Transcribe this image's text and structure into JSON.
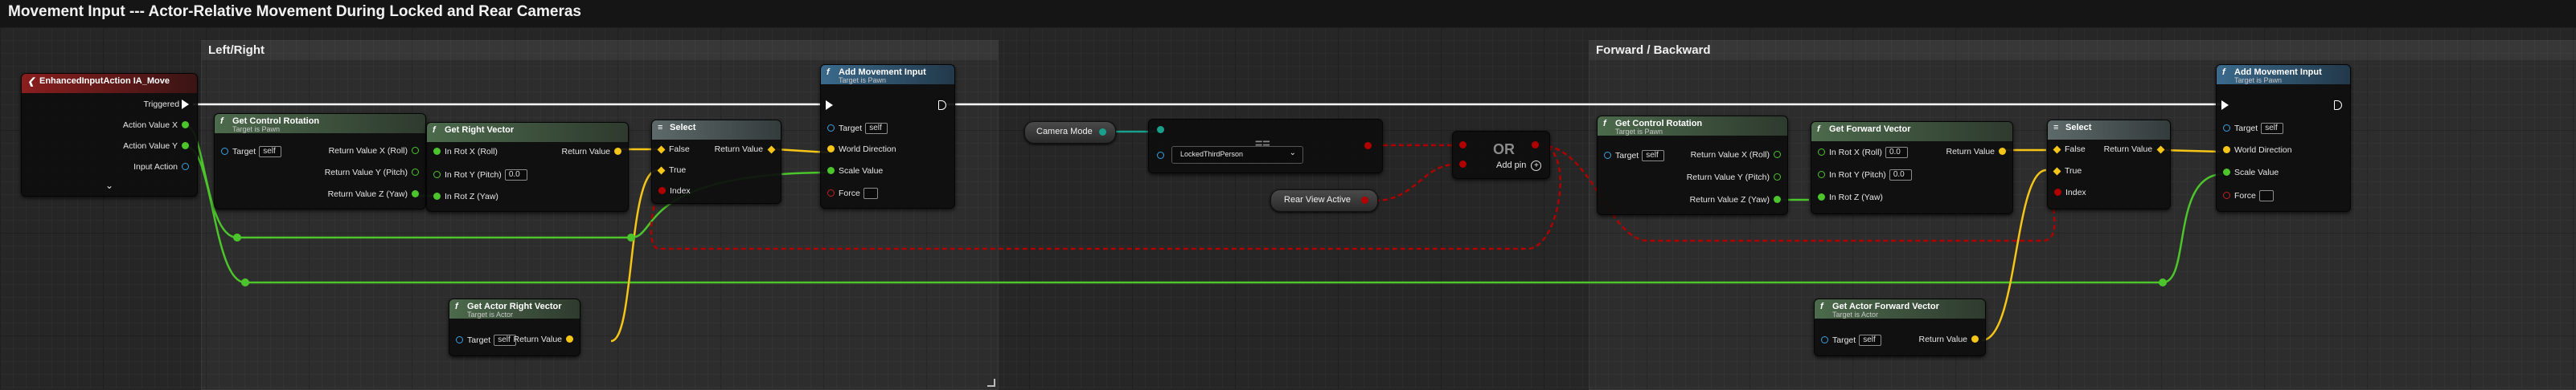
{
  "window": {
    "title": "Movement Input --- Actor-Relative Movement During Locked and Rear Cameras"
  },
  "comments": [
    {
      "id": "left_right",
      "label": "Left/Right"
    },
    {
      "id": "forward_backward",
      "label": "Forward / Backward"
    }
  ],
  "colors": {
    "exec": "#ffffff",
    "vector": "#f5c518",
    "float": "#4cc42c",
    "object": "#3aa0e0",
    "bool": "#b00000",
    "enum": "#1aa08a"
  },
  "nodes": {
    "input_action": {
      "title": "EnhancedInputAction IA_Move",
      "pins": [
        "Triggered",
        "Action Value X",
        "Action Value Y",
        "Input Action"
      ]
    },
    "gcr_left": {
      "title": "Get Control Rotation",
      "subtitle": "Target is Pawn",
      "pins": {
        "target": "Target",
        "target_val": "self",
        "x": "Return Value X (Roll)",
        "y": "Return Value Y (Pitch)",
        "z": "Return Value Z (Yaw)"
      }
    },
    "right_vec": {
      "title": "Get Right Vector",
      "pins": {
        "x": "In Rot X (Roll)",
        "y": "In Rot Y (Pitch)",
        "y_val": "0.0",
        "z": "In Rot Z (Yaw)",
        "ret": "Return Value"
      }
    },
    "select_left": {
      "title": "Select",
      "pins": {
        "false": "False",
        "true": "True",
        "index": "Index",
        "ret": "Return Value"
      }
    },
    "add_move_left": {
      "title": "Add Movement Input",
      "subtitle": "Target is Pawn",
      "pins": {
        "target": "Target",
        "target_val": "self",
        "world": "World Direction",
        "scale": "Scale Value",
        "force": "Force"
      }
    },
    "actor_right": {
      "title": "Get Actor Right Vector",
      "subtitle": "Target is Actor",
      "pins": {
        "target": "Target",
        "target_val": "self",
        "ret": "Return Value"
      }
    },
    "camera_mode": {
      "label": "Camera Mode"
    },
    "equal_enum": {
      "symbol": "==",
      "value": "LockedThirdPerson"
    },
    "rear_view": {
      "label": "Rear View Active"
    },
    "or_node": {
      "symbol": "OR",
      "add_pin": "Add pin"
    },
    "gcr_fwd": {
      "title": "Get Control Rotation",
      "subtitle": "Target is Pawn",
      "pins": {
        "target": "Target",
        "target_val": "self",
        "x": "Return Value X (Roll)",
        "y": "Return Value Y (Pitch)",
        "z": "Return Value Z (Yaw)"
      }
    },
    "fwd_vec": {
      "title": "Get Forward Vector",
      "pins": {
        "x": "In Rot X (Roll)",
        "x_val": "0.0",
        "y": "In Rot Y (Pitch)",
        "y_val": "0.0",
        "z": "In Rot Z (Yaw)",
        "ret": "Return Value"
      }
    },
    "select_fwd": {
      "title": "Select",
      "pins": {
        "false": "False",
        "true": "True",
        "index": "Index",
        "ret": "Return Value"
      }
    },
    "add_move_fwd": {
      "title": "Add Movement Input",
      "subtitle": "Target is Pawn",
      "pins": {
        "target": "Target",
        "target_val": "self",
        "world": "World Direction",
        "scale": "Scale Value",
        "force": "Force"
      }
    },
    "actor_fwd": {
      "title": "Get Actor Forward Vector",
      "subtitle": "Target is Actor",
      "pins": {
        "target": "Target",
        "target_val": "self",
        "ret": "Return Value"
      }
    }
  }
}
